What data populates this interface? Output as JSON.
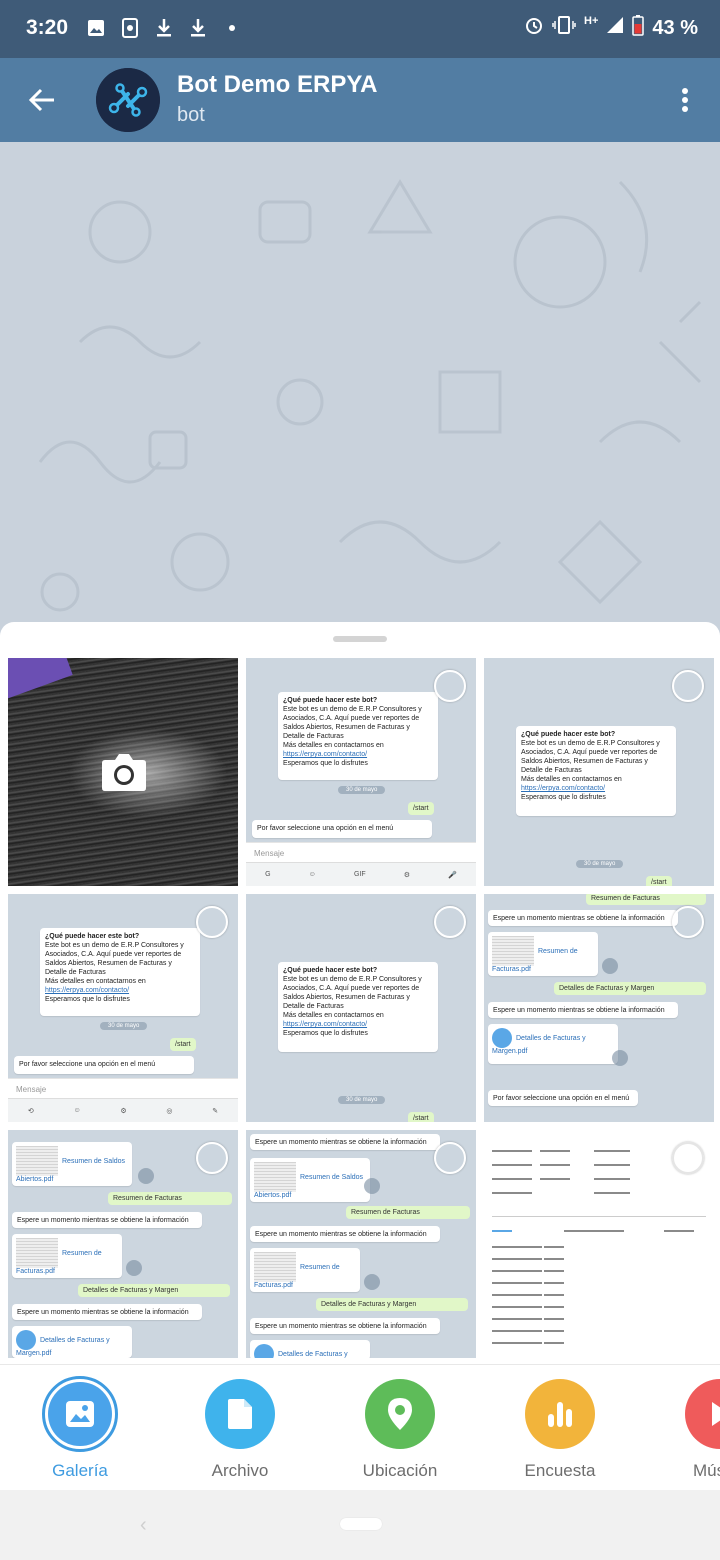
{
  "status_bar": {
    "time": "3:20",
    "network": "H+",
    "battery": "43 %",
    "icons": [
      "image-icon",
      "screenshot-icon",
      "download-icon",
      "download-icon",
      "dot-icon",
      "alarm-icon",
      "vibrate-icon",
      "signal-icon",
      "battery-icon"
    ]
  },
  "header": {
    "title": "Bot Demo ERPYA",
    "subtitle": "bot",
    "back_icon": "back-arrow-icon",
    "menu_icon": "more-vertical-icon"
  },
  "gallery": {
    "camera_icon": "camera-icon",
    "chat_shot": {
      "question": "¿Qué puede hacer este bot?",
      "body": "Este bot es un demo de E.R.P Consultores y Asociados, C.A. Aquí puede ver reportes de Saldos Abiertos, Resumen de Facturas y Detalle de Facturas",
      "contact": "Más detalles en contactarnos en",
      "link": "https://erpya.com/contacto/",
      "closing": "Esperamos que lo disfrutes",
      "date": "30 de mayo",
      "start": "/start",
      "prompt": "Por favor seleccione una opción en el menú",
      "input_placeholder": "Mensaje",
      "wait_msg": "Espere un momento mientras se obtiene la información",
      "file_saldos": "Resumen de Saldos Abiertos.pdf",
      "file_facturas": "Resumen de Facturas.pdf",
      "file_detalle": "Detalles de Facturas y Margen.pdf",
      "opt_resumen": "Resumen de Facturas",
      "opt_detalle": "Detalles de Facturas y Margen"
    }
  },
  "attach_options": [
    {
      "label": "Galería",
      "icon": "gallery-icon",
      "color": "#4aa3ea",
      "active": true
    },
    {
      "label": "Archivo",
      "icon": "file-icon",
      "color": "#3fb3ec"
    },
    {
      "label": "Ubicación",
      "icon": "location-icon",
      "color": "#5ebc59"
    },
    {
      "label": "Encuesta",
      "icon": "poll-icon",
      "color": "#f2b43b"
    },
    {
      "label": "Mús",
      "icon": "music-icon",
      "color": "#ef5b5b"
    }
  ]
}
